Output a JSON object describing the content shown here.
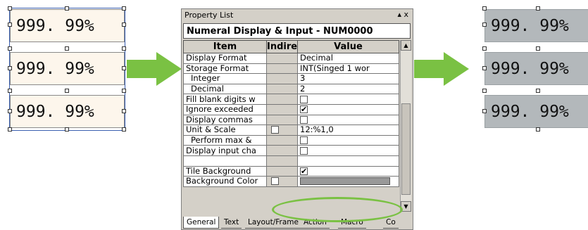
{
  "left_display": {
    "values": [
      "999. 99%",
      "999. 99%",
      "999. 99%"
    ]
  },
  "right_display": {
    "values": [
      "999. 99%",
      "999. 99%",
      "999. 99%"
    ]
  },
  "panel": {
    "title": "Property List",
    "controls": "▴ x",
    "header": "Numeral Display & Input - NUM0000",
    "columns": {
      "item": "Item",
      "indirect": "Indire",
      "value": "Value"
    },
    "rows": [
      {
        "item": "Display Format",
        "value": "Decimal",
        "type": "text"
      },
      {
        "item": "Storage Format",
        "value": "INT(Singed 1 wor",
        "type": "text"
      },
      {
        "item": "Integer",
        "value": "3",
        "type": "text",
        "indent": true
      },
      {
        "item": "Decimal",
        "value": "2",
        "type": "text",
        "indent": true
      },
      {
        "item": "Fill blank digits w",
        "value": "",
        "type": "check",
        "checked": false
      },
      {
        "item": "Ignore exceeded",
        "value": "",
        "type": "check",
        "checked": true
      },
      {
        "item": "Display commas",
        "value": "",
        "type": "check",
        "checked": false
      },
      {
        "item": "Unit & Scale",
        "value": "12:%1,0",
        "type": "text",
        "ind_check": true
      },
      {
        "item": "Perform max &",
        "value": "",
        "type": "check",
        "checked": false,
        "indent": true
      },
      {
        "item": "Display input cha",
        "value": "",
        "type": "check",
        "checked": false
      },
      {
        "item": "",
        "value": "",
        "type": "blank"
      },
      {
        "item": "Tile Background",
        "value": "",
        "type": "check",
        "checked": true
      },
      {
        "item": "Background Color",
        "value": "",
        "type": "color",
        "ind_check": true
      }
    ],
    "tabs": [
      "General",
      "Text",
      "Layout/Frame",
      "Action",
      "Macro",
      "Co"
    ],
    "check_mark": "✔"
  },
  "colors": {
    "left_bg": "#fdf6ec",
    "right_bg": "#b3b8bb",
    "arrow": "#7ac143",
    "bg_swatch": "#999999"
  }
}
